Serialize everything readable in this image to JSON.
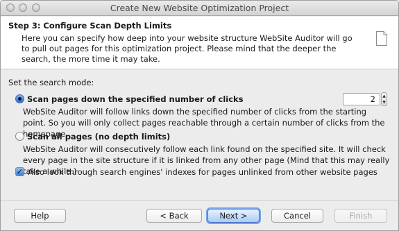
{
  "window": {
    "title": "Create New Website Optimization Project"
  },
  "header": {
    "step_title": "Step 3: Configure Scan Depth Limits",
    "description": "Here you can specify how deep into  your website structure WebSite Auditor will go to pull out pages for this optimization project. Please mind that the deeper the search, the more time it may take.",
    "icon": "document-icon"
  },
  "form": {
    "mode_label": "Set the search mode:",
    "options": [
      {
        "label": "Scan pages down the specified number of clicks",
        "description": "WebSite Auditor will follow links down the specified number of clicks from the starting point. So you will only collect pages reachable through a certain number of clicks from the homepage.",
        "selected": true
      },
      {
        "label": "Scan all pages (no depth limits)",
        "description": "WebSite Auditor will consecutively follow each link found on the specified site. It will check every page in the site structure if it is linked from any other page (Mind that this may really take a while.)",
        "selected": false
      }
    ],
    "clicks_value": "2",
    "also_look_label": "Also look through search engines' indexes for pages unlinked from other website pages",
    "also_look_checked": true
  },
  "buttons": {
    "help": "Help",
    "back": "< Back",
    "next": "Next >",
    "cancel": "Cancel",
    "finish": "Finish"
  },
  "colors": {
    "accent": "#3a7fd9",
    "header_bg": "#ffffff",
    "window_bg": "#ececec"
  }
}
